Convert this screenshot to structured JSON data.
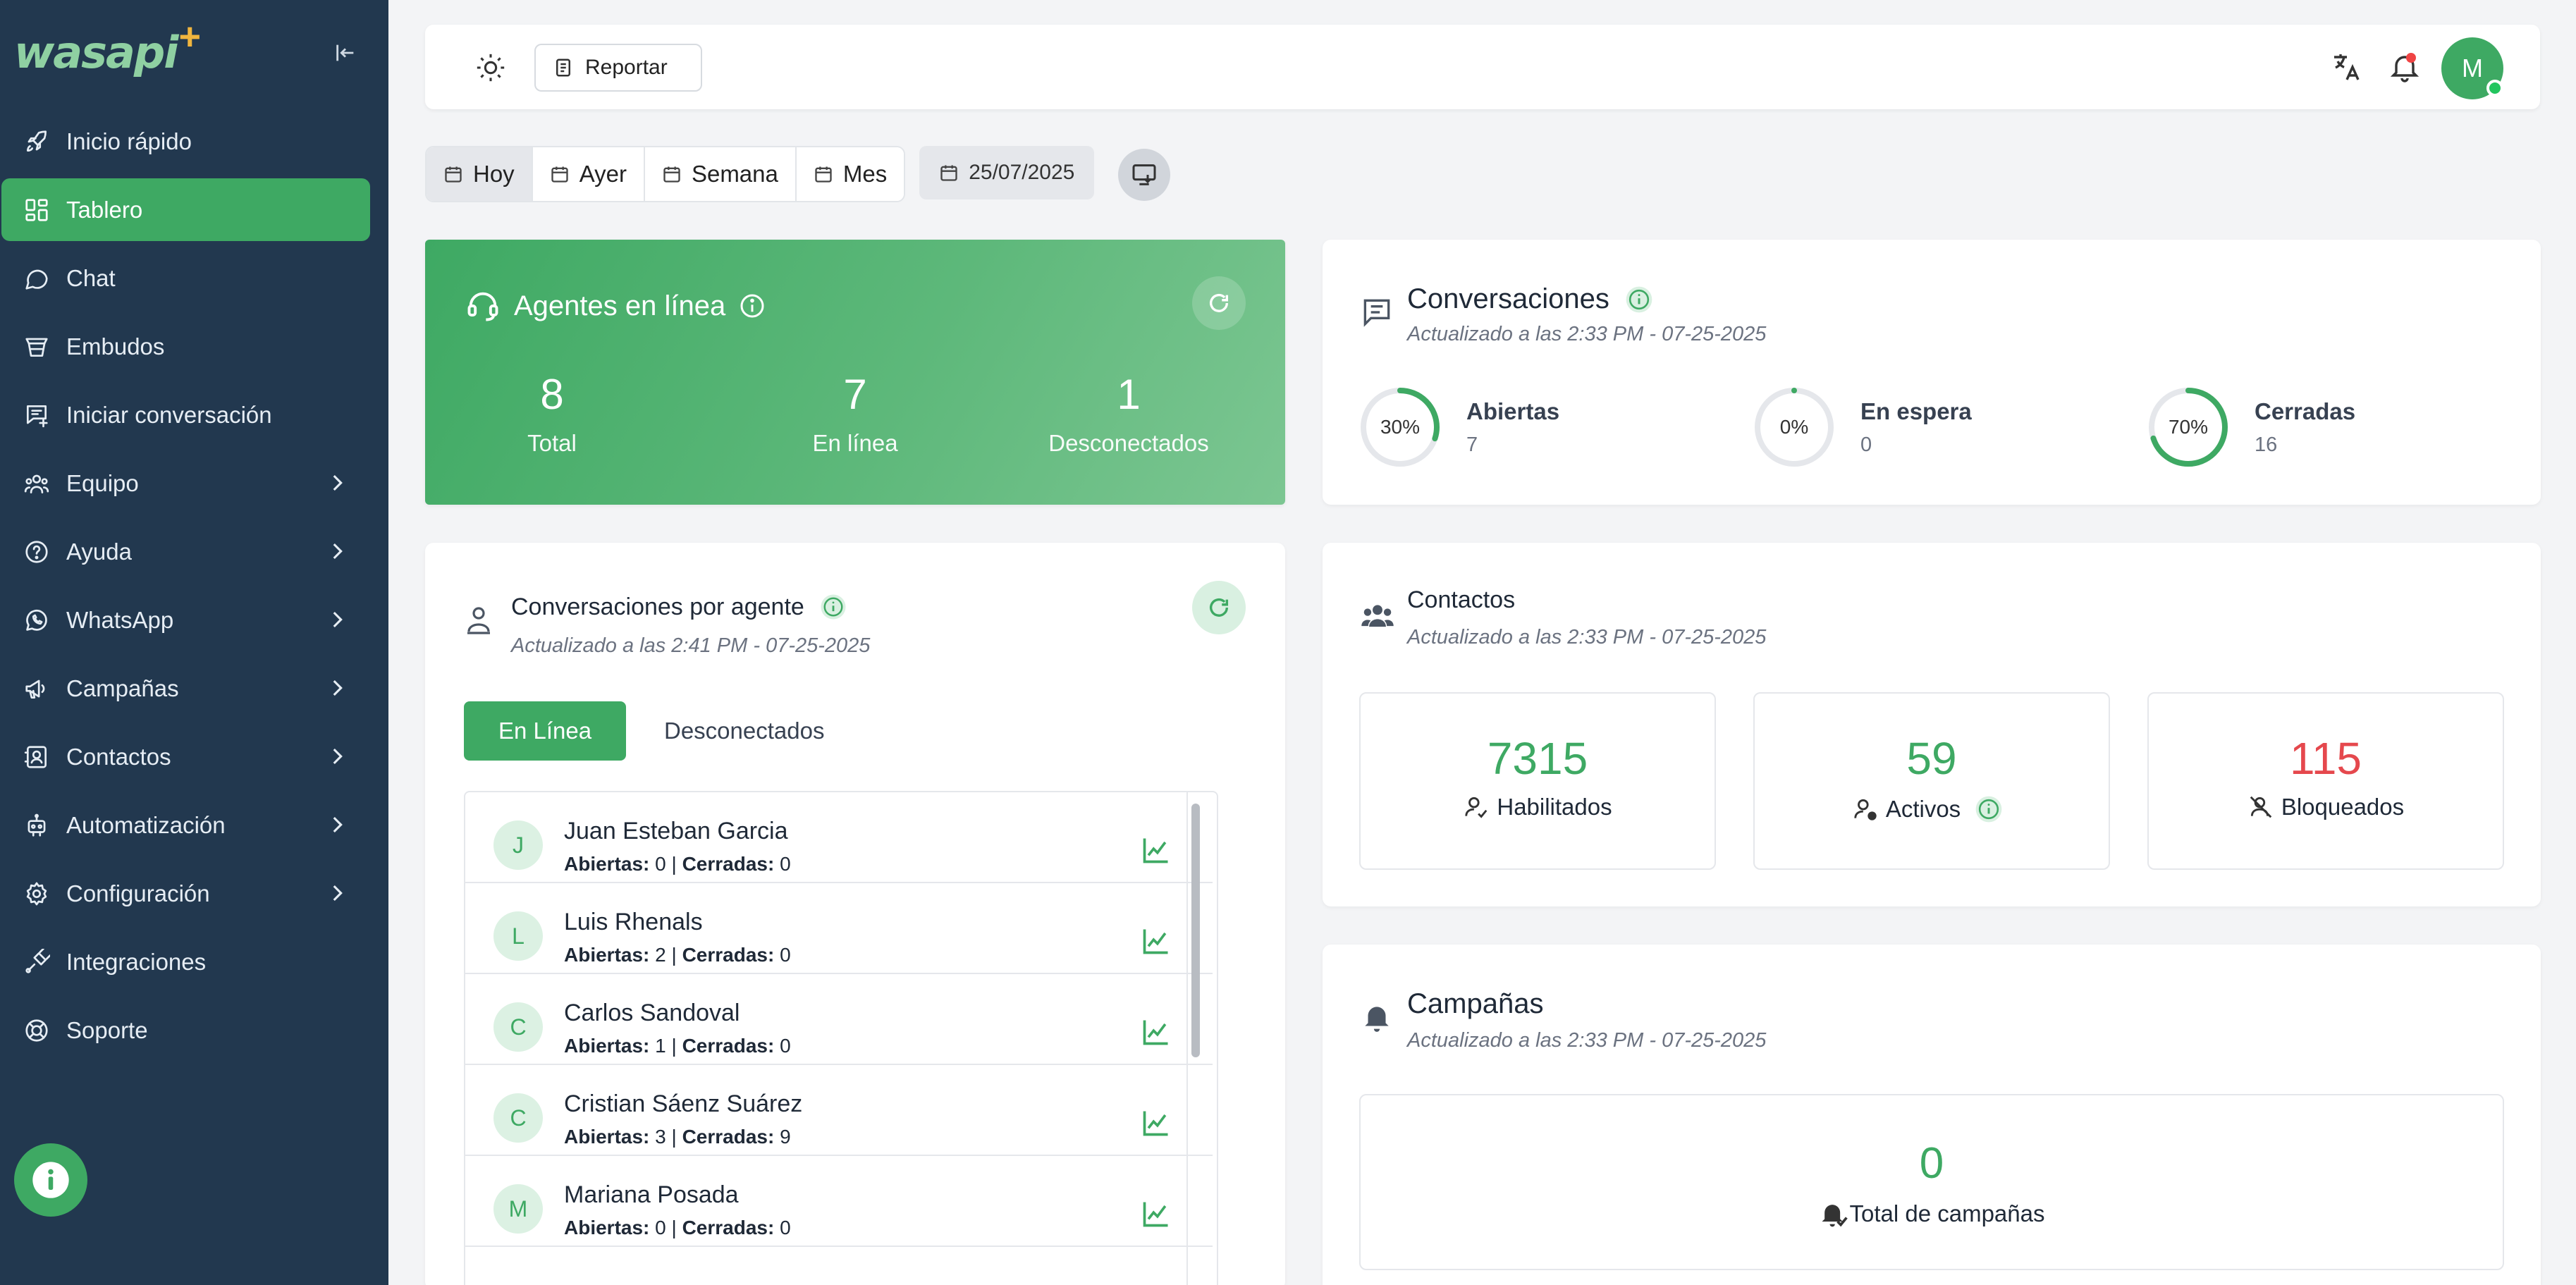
{
  "app": {
    "logo_text": "wasapi",
    "logo_plus": "+"
  },
  "sidebar": {
    "items": [
      {
        "label": "Inicio rápido",
        "icon": "rocket-icon",
        "chevron": false,
        "active": false
      },
      {
        "label": "Tablero",
        "icon": "dashboard-icon",
        "chevron": false,
        "active": true
      },
      {
        "label": "Chat",
        "icon": "chat-icon",
        "chevron": false,
        "active": false
      },
      {
        "label": "Embudos",
        "icon": "funnel-icon",
        "chevron": false,
        "active": false
      },
      {
        "label": "Iniciar conversación",
        "icon": "new-message-icon",
        "chevron": false,
        "active": false
      },
      {
        "label": "Equipo",
        "icon": "team-icon",
        "chevron": true,
        "active": false
      },
      {
        "label": "Ayuda",
        "icon": "help-icon",
        "chevron": true,
        "active": false
      },
      {
        "label": "WhatsApp",
        "icon": "whatsapp-icon",
        "chevron": true,
        "active": false
      },
      {
        "label": "Campañas",
        "icon": "megaphone-icon",
        "chevron": true,
        "active": false
      },
      {
        "label": "Contactos",
        "icon": "contacts-icon",
        "chevron": true,
        "active": false
      },
      {
        "label": "Automatización",
        "icon": "robot-icon",
        "chevron": true,
        "active": false
      },
      {
        "label": "Configuración",
        "icon": "gear-icon",
        "chevron": true,
        "active": false
      },
      {
        "label": "Integraciones",
        "icon": "plug-icon",
        "chevron": false,
        "active": false
      },
      {
        "label": "Soporte",
        "icon": "lifebuoy-icon",
        "chevron": false,
        "active": false
      }
    ]
  },
  "topbar": {
    "report_label": "Reportar",
    "avatar_initial": "M"
  },
  "filters": {
    "periods": [
      "Hoy",
      "Ayer",
      "Semana",
      "Mes"
    ],
    "active_period": "Hoy",
    "date": "25/07/2025"
  },
  "agents_online": {
    "title": "Agentes en línea",
    "stats": [
      {
        "value": "8",
        "label": "Total"
      },
      {
        "value": "7",
        "label": "En línea"
      },
      {
        "value": "1",
        "label": "Desconectados"
      }
    ]
  },
  "conversations": {
    "title": "Conversaciones",
    "updated": "Actualizado a las 2:33 PM - 07-25-2025",
    "items": [
      {
        "percent": "30%",
        "label": "Abiertas",
        "count": "7",
        "fraction": 0.3
      },
      {
        "percent": "0%",
        "label": "En espera",
        "count": "0",
        "fraction": 0
      },
      {
        "percent": "70%",
        "label": "Cerradas",
        "count": "16",
        "fraction": 0.7
      }
    ]
  },
  "conv_by_agent": {
    "title": "Conversaciones por agente",
    "updated": "Actualizado a las 2:41 PM - 07-25-2025",
    "tab_online": "En Línea",
    "tab_offline": "Desconectados",
    "open_label": "Abiertas:",
    "closed_label": "Cerradas:",
    "agents": [
      {
        "initial": "J",
        "name": "Juan Esteban Garcia",
        "open": "0",
        "closed": "0"
      },
      {
        "initial": "L",
        "name": "Luis Rhenals",
        "open": "2",
        "closed": "0"
      },
      {
        "initial": "C",
        "name": "Carlos Sandoval",
        "open": "1",
        "closed": "0"
      },
      {
        "initial": "C",
        "name": "Cristian Sáenz Suárez",
        "open": "3",
        "closed": "9"
      },
      {
        "initial": "M",
        "name": "Mariana Posada",
        "open": "0",
        "closed": "0"
      }
    ]
  },
  "contacts": {
    "title": "Contactos",
    "updated": "Actualizado a las 2:33 PM - 07-25-2025",
    "items": [
      {
        "value": "7315",
        "label": "Habilitados",
        "color": "#3ea963"
      },
      {
        "value": "59",
        "label": "Activos",
        "color": "#3ea963"
      },
      {
        "value": "115",
        "label": "Bloqueados",
        "color": "#e5484d"
      }
    ]
  },
  "campaigns": {
    "title": "Campañas",
    "updated": "Actualizado a las 2:33 PM - 07-25-2025",
    "total_value": "0",
    "total_label": "Total de campañas"
  },
  "colors": {
    "brand": "#3ea963",
    "sidebar": "#22384f",
    "danger": "#e5484d"
  }
}
